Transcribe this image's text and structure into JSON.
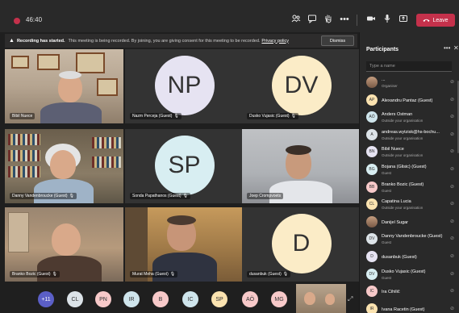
{
  "topbar": {
    "timer": "46:40",
    "leave_label": "Leave",
    "icons": [
      "people-icon",
      "chat-icon",
      "raise-hand-icon",
      "more-icon",
      "camera-icon",
      "mic-icon",
      "share-icon",
      "phone-icon"
    ]
  },
  "banner": {
    "title": "Recording has started.",
    "text": "This meeting is being recorded. By joining, you are giving consent for this meeting to be recorded.",
    "link": "Privacy policy",
    "dismiss": "Dismiss"
  },
  "tiles": [
    {
      "id": "bibi",
      "name": "Bibil Nuece",
      "kind": "video"
    },
    {
      "id": "np",
      "name": "Nazm Perceja (Guest)",
      "kind": "avatar",
      "initials": "NP"
    },
    {
      "id": "dv",
      "name": "Dusko Vujasic (Guest)",
      "kind": "avatar",
      "initials": "DV"
    },
    {
      "id": "danny",
      "name": "Danny Vandenbroucke (Guest)",
      "kind": "video"
    },
    {
      "id": "sp",
      "name": "Sonda Papathanos (Guest)",
      "kind": "avatar",
      "initials": "SP"
    },
    {
      "id": "joep",
      "name": "Joep Crompvoets",
      "kind": "video"
    },
    {
      "id": "branko",
      "name": "Branko Bozic (Guest)",
      "kind": "video"
    },
    {
      "id": "murat",
      "name": "Murat Meha (Guest)",
      "kind": "video"
    },
    {
      "id": "d",
      "name": "dusanbuk (Guest)",
      "kind": "avatar",
      "initials": "D"
    }
  ],
  "strip": {
    "more": "+11",
    "bubbles": [
      "CL",
      "PN",
      "IR",
      "B",
      "IC",
      "SP",
      "AÖ",
      "MG"
    ]
  },
  "panel": {
    "title": "Participants",
    "search_placeholder": "Type a name",
    "participants": [
      {
        "initials": "",
        "name": "...",
        "sub": "Organiser",
        "photo": true
      },
      {
        "initials": "AP",
        "name": "Alexandru Pantaz (Guest)",
        "sub": ""
      },
      {
        "initials": "AÖ",
        "name": "Anders Östman",
        "sub": "Outside your organisation"
      },
      {
        "initials": "A",
        "name": "andreas.wytzisk@hs-bochu...",
        "sub": "Outside your organisation"
      },
      {
        "initials": "BN",
        "name": "Bibil Nuece",
        "sub": "Outside your organisation"
      },
      {
        "initials": "BG",
        "name": "Bojana (Glisic) (Guest)",
        "sub": "Guest"
      },
      {
        "initials": "BB",
        "name": "Branko Bozic (Guest)",
        "sub": "Guest"
      },
      {
        "initials": "CL",
        "name": "Capatina Lucia",
        "sub": "Outside your organisation"
      },
      {
        "initials": "",
        "name": "Danijel Šugar",
        "sub": "",
        "photo": true
      },
      {
        "initials": "DV",
        "name": "Danny Vandenbroucke (Guest)",
        "sub": "Guest"
      },
      {
        "initials": "D",
        "name": "dusanbuk (Guest)",
        "sub": ""
      },
      {
        "initials": "DV",
        "name": "Dusko Vujasic (Guest)",
        "sub": "Guest"
      },
      {
        "initials": "IC",
        "name": "Ira Cihilič",
        "sub": ""
      },
      {
        "initials": "IR",
        "name": "Ivana Racetin (Guest)",
        "sub": ""
      }
    ]
  },
  "colors": {
    "accent": "#5b5fc7",
    "leave": "#c4314b",
    "panel_bg": "#292929",
    "stage_bg": "#1f1f1f"
  }
}
